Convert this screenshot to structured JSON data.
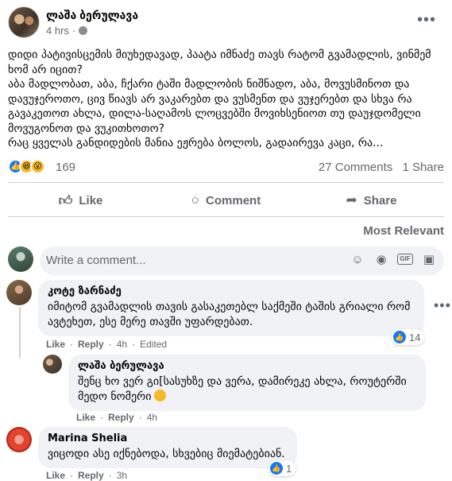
{
  "post": {
    "author": "ლაშა ბერულავა",
    "time": "4 hrs",
    "time_separator": "·",
    "text_lines": [
      "დიდი პატივისცემის მიუხედავად, პაატა იმნაძე თავს რატომ გვამადლის, ვინმემ",
      "ხომ არ იცით?",
      "აბა მადლობათ, აბა, ჩქარი ტაში მადლობის ნიშნადო, აბა, მოვუსმინოთ და",
      "დავუჯეროთო, ცივ წიავს არ ვაკარებთ და ვუსმენთ და ვუჯერებთ და სხვა რა",
      "გავაკეთოთ ახლა, დილა-საღამოს ლოცვებში მოვიხსენიოთ თუ დაუჯდომელი",
      "მოვუგონოთ და ვუკითხოთო?",
      "რაც ყველას განდიდების მანია ეჟრება ბოლოს, გადაირევა კაცი, რა..."
    ],
    "reaction_count": "169",
    "comments_count": "27 Comments",
    "shares_count": "1 Share"
  },
  "actions": {
    "like": "Like",
    "comment": "Comment",
    "share": "Share"
  },
  "sort_label": "Most Relevant",
  "composer": {
    "placeholder": "Write a comment..."
  },
  "comments": [
    {
      "author": "კოტე ზარნაძე",
      "text_lines": [
        "იმიტომ გვამადლის თავის გასაკეთებლ საქმეში ტაშის გრიალი რომ",
        "ავტეხეთ, ესე მერე თავში უფარდებათ."
      ],
      "like_label": "Like",
      "reply_label": "Reply",
      "time": "4h",
      "edited": "Edited",
      "reaction_count": "14"
    },
    {
      "author": "ლაშა ბერულავა",
      "text_lines": [
        "შენც ხო ვერ გი[სასუხზე და ვერა, დამირეკე ახლა, როუტერში",
        "მედო ნომერი"
      ],
      "like_label": "Like",
      "reply_label": "Reply",
      "time": "4h"
    },
    {
      "author": "Marina Shelia",
      "text_lines": [
        "ვიცოდი ასე იქნებოდა, სხვებიც მიემატებიან."
      ],
      "like_label": "Like",
      "reply_label": "Reply",
      "time": "3h",
      "reaction_count": "1"
    }
  ],
  "icons": {
    "post_menu": "more-horizontal-icon",
    "privacy": "globe-icon",
    "like_action": "thumbs-up-icon",
    "comment_action": "speech-bubble-icon",
    "share_action": "share-arrow-icon"
  },
  "colors": {
    "accent": "#1877f2",
    "muted_text": "#65676b",
    "bubble_bg": "#f0f2f5"
  }
}
